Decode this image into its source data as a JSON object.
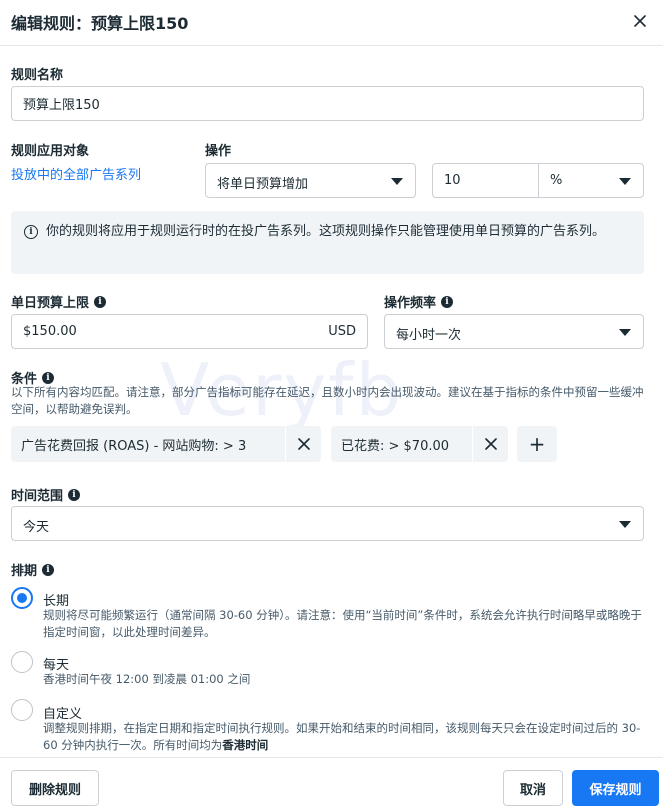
{
  "dialog": {
    "title": "编辑规则：预算上限150"
  },
  "rule_name": {
    "label": "规则名称",
    "value": "预算上限150"
  },
  "apply_target": {
    "label": "规则应用对象",
    "link": "投放中的全部广告系列"
  },
  "action": {
    "label": "操作",
    "type_selected": "将单日预算增加",
    "amount": "10",
    "unit_selected": "%"
  },
  "notice": {
    "text": "你的规则将应用于规则运行时的在投广告系列。这项规则操作只能管理使用单日预算的广告系列。"
  },
  "daily_budget_cap": {
    "label": "单日预算上限",
    "value": "$150.00",
    "currency": "USD"
  },
  "action_frequency": {
    "label": "操作频率",
    "selected": "每小时一次"
  },
  "conditions": {
    "label": "条件",
    "description": "以下所有内容均匹配。请注意，部分广告指标可能存在延迟，且数小时内会出现波动。建议在基于指标的条件中预留一些缓冲空间，以帮助避免误判。",
    "items": [
      {
        "text": "广告花费回报 (ROAS) - 网站购物:  >  3"
      },
      {
        "text": "已花费:  >  $70.00"
      }
    ],
    "add_label": "+"
  },
  "time_range": {
    "label": "时间范围",
    "selected": "今天"
  },
  "schedule": {
    "label": "排期",
    "options": [
      {
        "title": "长期",
        "desc": "规则将尽可能频繁运行（通常间隔 30-60 分钟）。请注意：使用“当前时间”条件时，系统会允许执行时间略早或略晚于指定时间窗，以此处理时间差异。",
        "selected": true
      },
      {
        "title": "每天",
        "desc": "香港时间午夜 12:00 到凌晨 01:00 之间",
        "selected": false
      },
      {
        "title": "自定义",
        "desc": "调整规则排期，在指定日期和指定时间执行规则。如果开始和结束的时间相同，该规则每天只会在设定时间过后的 30-60 分钟内执行一次。所有时间均为",
        "desc_bold": "香港时间",
        "selected": false
      }
    ]
  },
  "footer": {
    "delete_label": "删除规则",
    "cancel_label": "取消",
    "save_label": "保存规则"
  },
  "watermark": "Veryfb",
  "colors": {
    "accent": "#1877f2",
    "text": "#1c2b33",
    "notice_bg": "#f1f4f7",
    "border": "#ccd0d5"
  }
}
